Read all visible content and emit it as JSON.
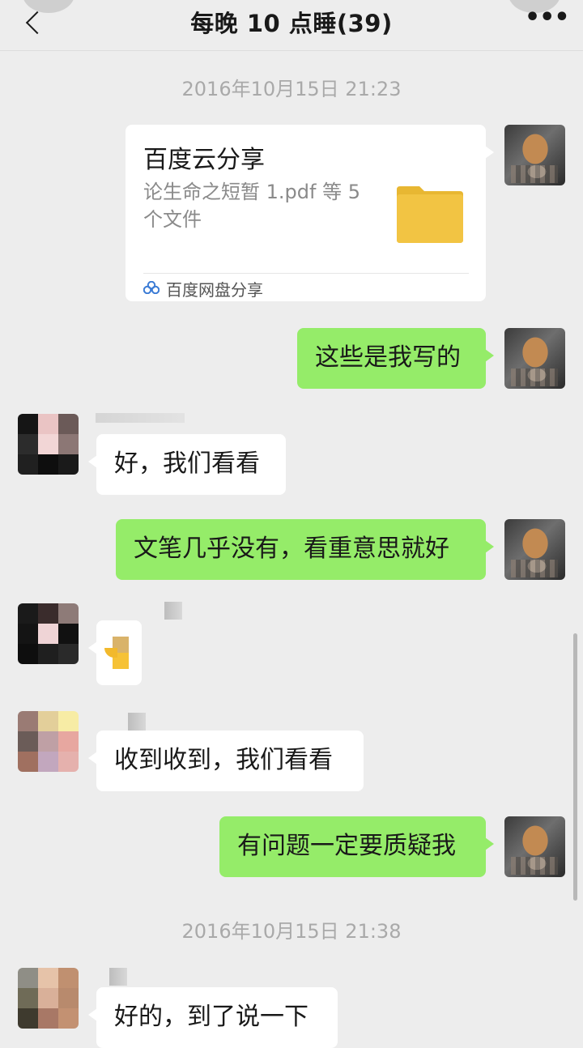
{
  "header": {
    "back_icon": "chevron-left-icon",
    "title": "每晚 10 点睡(39)",
    "more_label": "•••",
    "more_icon": "more-icon"
  },
  "messages": {
    "time_1": "2016年10月15日 21:23",
    "share_card": {
      "title": "百度云分享",
      "description": "论生命之短暂 1.pdf 等 5 个文件",
      "icon": "folder-icon",
      "source_icon": "baidu-netdisk-icon",
      "source": "百度网盘分享"
    },
    "self_1": "这些是我写的",
    "other_1": "好，我们看看",
    "self_2": "文笔几乎没有，看重意思就好",
    "other_2_emoji": "emoji-sticker",
    "other_3": "收到收到，我们看看",
    "self_3": "有问题一定要质疑我",
    "time_2": "2016年10月15日 21:38",
    "other_4": "好的，到了说一下"
  },
  "colors": {
    "background": "#ededed",
    "sent_bubble": "#95ec69",
    "received_bubble": "#ffffff",
    "timestamp": "#a9a9a9",
    "folder": "#f2c443"
  }
}
